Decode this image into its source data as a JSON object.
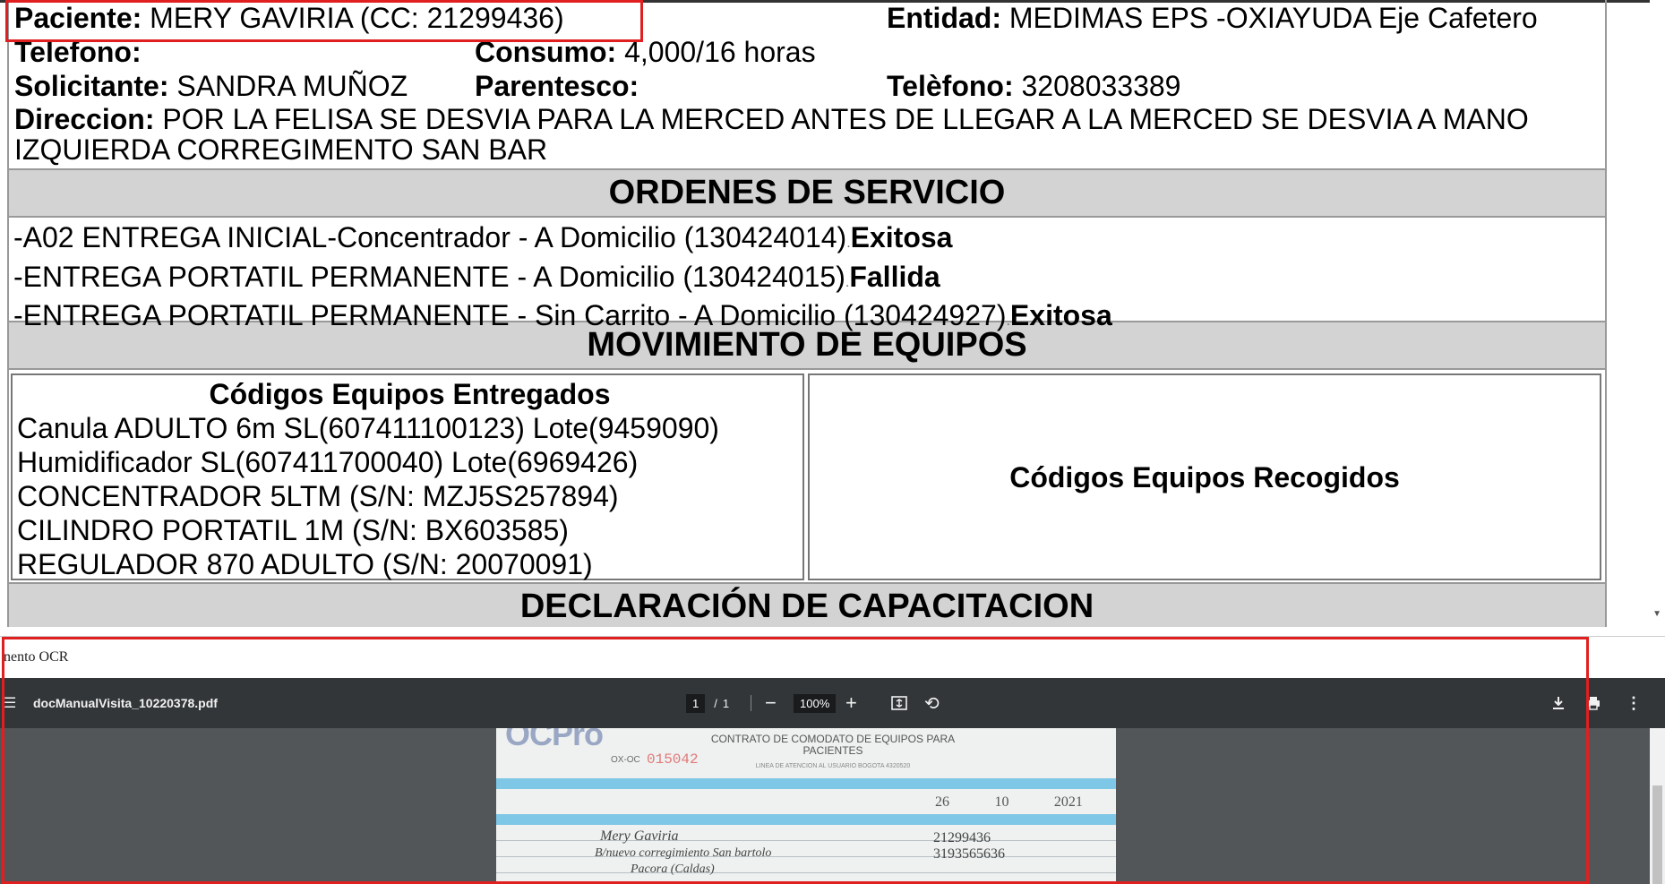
{
  "patient": {
    "label": "Paciente:",
    "value": "MERY GAVIRIA (CC: 21299436)",
    "entity_label": "Entidad:",
    "entity_value": "MEDIMAS EPS -OXIAYUDA Eje Cafetero",
    "phone_label": "Telefono:",
    "phone_value": "",
    "consumption_label": "Consumo:",
    "consumption_value": "4,000/16 horas",
    "requester_label": "Solicitante:",
    "requester_value": "SANDRA MUÑOZ",
    "relationship_label": "Parentesco:",
    "relationship_value": "",
    "phone2_label": "Telèfono:",
    "phone2_value": "3208033389",
    "address_label": "Direccion:",
    "address_value": "POR LA FELISA SE DESVIA PARA LA MERCED ANTES DE LLEGAR A LA MERCED SE DESVIA A MANO IZQUIERDA CORREGIMENTO SAN BAR"
  },
  "orders": {
    "title": "ORDENES DE SERVICIO",
    "items": [
      {
        "text": "-A02 ENTREGA INICIAL-Concentrador - A Domicilio (130424014)",
        "status": "Exitosa"
      },
      {
        "text": "-ENTREGA PORTATIL PERMANENTE - A Domicilio (130424015)",
        "status": "Fallida"
      },
      {
        "text": "-ENTREGA PORTATIL PERMANENTE - Sin Carrito - A Domicilio (130424927)",
        "status": "Exitosa"
      }
    ]
  },
  "equipment": {
    "title": "MOVIMIENTO DE EQUIPOS",
    "delivered_title": "Códigos Equipos Entregados",
    "delivered": [
      "Canula ADULTO 6m SL(607411100123) Lote(9459090)",
      "Humidificador SL(607411700040) Lote(6969426)",
      "CONCENTRADOR 5LTM (S/N: MZJ5S257894)",
      "CILINDRO PORTATIL 1M (S/N: BX603585)",
      "REGULADOR 870 ADULTO (S/N: 20070091)"
    ],
    "collected_title": "Códigos Equipos Recogidos"
  },
  "training": {
    "title": "DECLARACIÓN DE CAPACITACION"
  },
  "ocr": {
    "label": "nento OCR"
  },
  "viewer": {
    "filename": "docManualVisita_10220378.pdf",
    "page_current": "1",
    "page_sep": "/",
    "page_total": "1",
    "zoom": "100%",
    "icons": {
      "menu": "menu-icon",
      "zoom_out": "minus-icon",
      "zoom_in": "plus-icon",
      "fit": "fit-page-icon",
      "rotate": "rotate-icon",
      "download": "download-icon",
      "print": "print-icon",
      "more": "more-vertical-icon"
    }
  },
  "scan": {
    "logo": "OCPro",
    "form_no_label": "OX-OC",
    "form_no": "015042",
    "heading": "CONTRATO DE COMODATO DE EQUIPOS PARA PACIENTES",
    "sub": "LINEA DE ATENCION AL USUARIO BOGOTA 4320520",
    "date": [
      "26",
      "10",
      "2021"
    ],
    "hand_name": "Mery Gaviria",
    "hand_id": "21299436",
    "hand_address": "B/nuevo corregimiento San bartolo",
    "hand_phone": "3193565636",
    "hand_place": "Pacora (Caldas)"
  },
  "colors": {
    "annotation": "#e02020",
    "toolbar": "#323639",
    "canvas": "#525659",
    "header_bg": "#d3d3d3"
  }
}
